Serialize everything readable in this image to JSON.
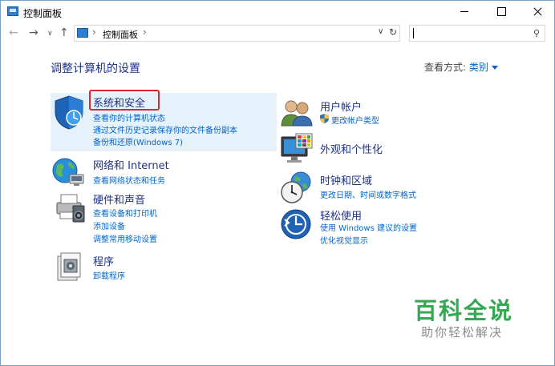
{
  "window": {
    "title": "控制面板"
  },
  "address": {
    "path": "控制面板",
    "separator": "›"
  },
  "search": {
    "placeholder": ""
  },
  "content": {
    "heading": "调整计算机的设置",
    "view_by_label": "查看方式:",
    "view_by_value": "类别"
  },
  "categories_left": [
    {
      "title": "系统和安全",
      "icon": "shield-icon",
      "links": [
        "查看你的计算机状态",
        "通过文件历史记录保存你的文件备份副本",
        "备份和还原(Windows 7)"
      ]
    },
    {
      "title": "网络和 Internet",
      "icon": "globe-network-icon",
      "links": [
        "查看网络状态和任务"
      ]
    },
    {
      "title": "硬件和声音",
      "icon": "printer-icon",
      "links": [
        "查看设备和打印机",
        "添加设备",
        "调整常用移动设置"
      ]
    },
    {
      "title": "程序",
      "icon": "programs-icon",
      "links": [
        "卸载程序"
      ]
    }
  ],
  "categories_right": [
    {
      "title": "用户帐户",
      "icon": "users-icon",
      "links": [
        "更改帐户类型"
      ]
    },
    {
      "title": "外观和个性化",
      "icon": "monitor-palette-icon",
      "links": []
    },
    {
      "title": "时钟和区域",
      "icon": "clock-globe-icon",
      "links": [
        "更改日期、时间或数字格式"
      ]
    },
    {
      "title": "轻松使用",
      "icon": "ease-of-access-icon",
      "links": [
        "使用 Windows 建议的设置",
        "优化视觉显示"
      ]
    }
  ],
  "watermark": {
    "title": "百科全说",
    "subtitle": "助你轻松解决"
  },
  "colors": {
    "heading": "#1e3287",
    "link": "#0066cc",
    "highlight": "#e5f1fb",
    "annotation_box": "#d9282f",
    "watermark": "#35a853"
  }
}
